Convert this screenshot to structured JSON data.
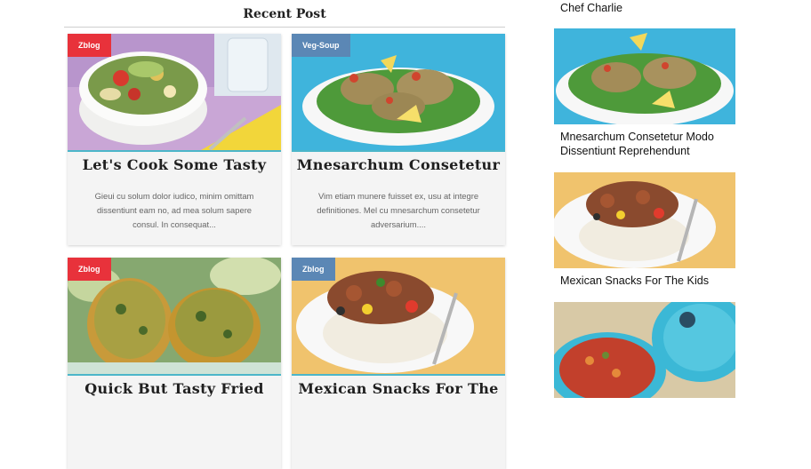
{
  "recent_post": {
    "heading": "Recent Post"
  },
  "cards": [
    {
      "category": "Zblog",
      "category_color": "#e8323b",
      "title": "Let's Cook Some Tasty",
      "excerpt": "Gieui cu solum dolor iudico, minim omittam dissentiunt eam no, ad mea solum sapere consul. In consequat..."
    },
    {
      "category": "Veg-Soup",
      "category_color": "#5b87b5",
      "title": "Mnesarchum Consetetur",
      "excerpt": "Vim etiam munere fuisset ex, usu at integre definitiones. Mel cu mnesarchum consetetur adversarium...."
    },
    {
      "category": "Zblog",
      "category_color": "#e8323b",
      "title": "Quick But Tasty Fried",
      "excerpt": ""
    },
    {
      "category": "Zblog",
      "category_color": "#5b87b5",
      "title": "Mexican Snacks For The",
      "excerpt": ""
    }
  ],
  "sidebar": {
    "items": [
      {
        "title": "Chef Charlie"
      },
      {
        "title": "Mnesarchum Consetetur Modo Dissentiunt Reprehendunt"
      },
      {
        "title": "Mexican Snacks For The Kids"
      },
      {
        "title": ""
      }
    ]
  },
  "colors": {
    "badge_red": "#e8323b",
    "badge_blue": "#5b87b5",
    "image_underline": "#4cb6c9"
  }
}
